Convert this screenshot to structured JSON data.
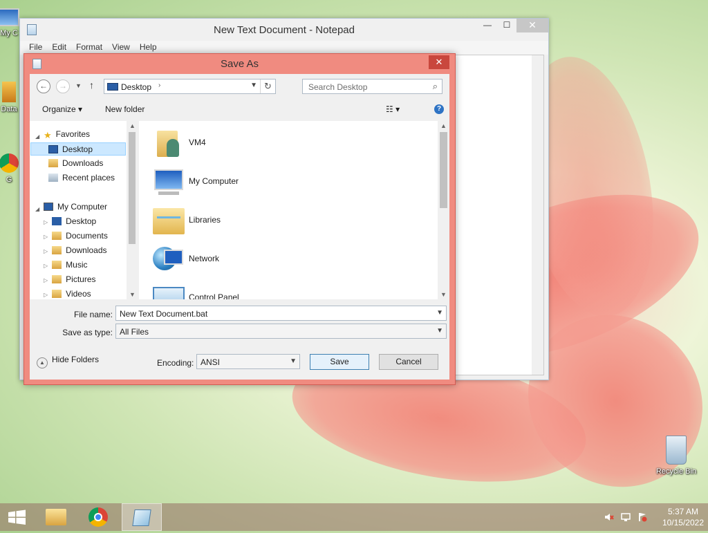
{
  "desktop": {
    "icons": [
      {
        "label": "My C",
        "pos": "top-left"
      },
      {
        "label": "Data",
        "pos": "left"
      },
      {
        "label": "G",
        "pos": "left"
      },
      {
        "label": "Recycle Bin",
        "pos": "bottom-right"
      }
    ]
  },
  "notepad": {
    "title": "New Text Document - Notepad",
    "menu": [
      "File",
      "Edit",
      "Format",
      "View",
      "Help"
    ],
    "controls": {
      "minimize": "—",
      "maximize": "☐",
      "close": "✕"
    }
  },
  "save_dialog": {
    "title": "Save As",
    "close": "✕",
    "address": {
      "location": "Desktop",
      "sep": "›"
    },
    "search_placeholder": "Search Desktop",
    "toolbar": {
      "organize": "Organize ▾",
      "new_folder": "New folder",
      "help": "?"
    },
    "nav": {
      "favorites": "Favorites",
      "fav_items": [
        "Desktop",
        "Downloads",
        "Recent places"
      ],
      "my_computer": "My Computer",
      "pc_items": [
        "Desktop",
        "Documents",
        "Downloads",
        "Music",
        "Pictures",
        "Videos"
      ]
    },
    "items": [
      "VM4",
      "My Computer",
      "Libraries",
      "Network",
      "Control Panel"
    ],
    "file_name_label": "File name:",
    "file_name": "New Text Document.bat",
    "save_type_label": "Save as type:",
    "save_type": "All Files",
    "encoding_label": "Encoding:",
    "encoding": "ANSI",
    "save_button": "Save",
    "cancel_button": "Cancel",
    "hide_folders": "Hide Folders"
  },
  "taskbar": {
    "time": "5:37 AM",
    "date": "10/15/2022"
  },
  "colors": {
    "dialog_frame": "#f08b80",
    "selection": "#cce8ff",
    "taskbar": "#966e64"
  }
}
